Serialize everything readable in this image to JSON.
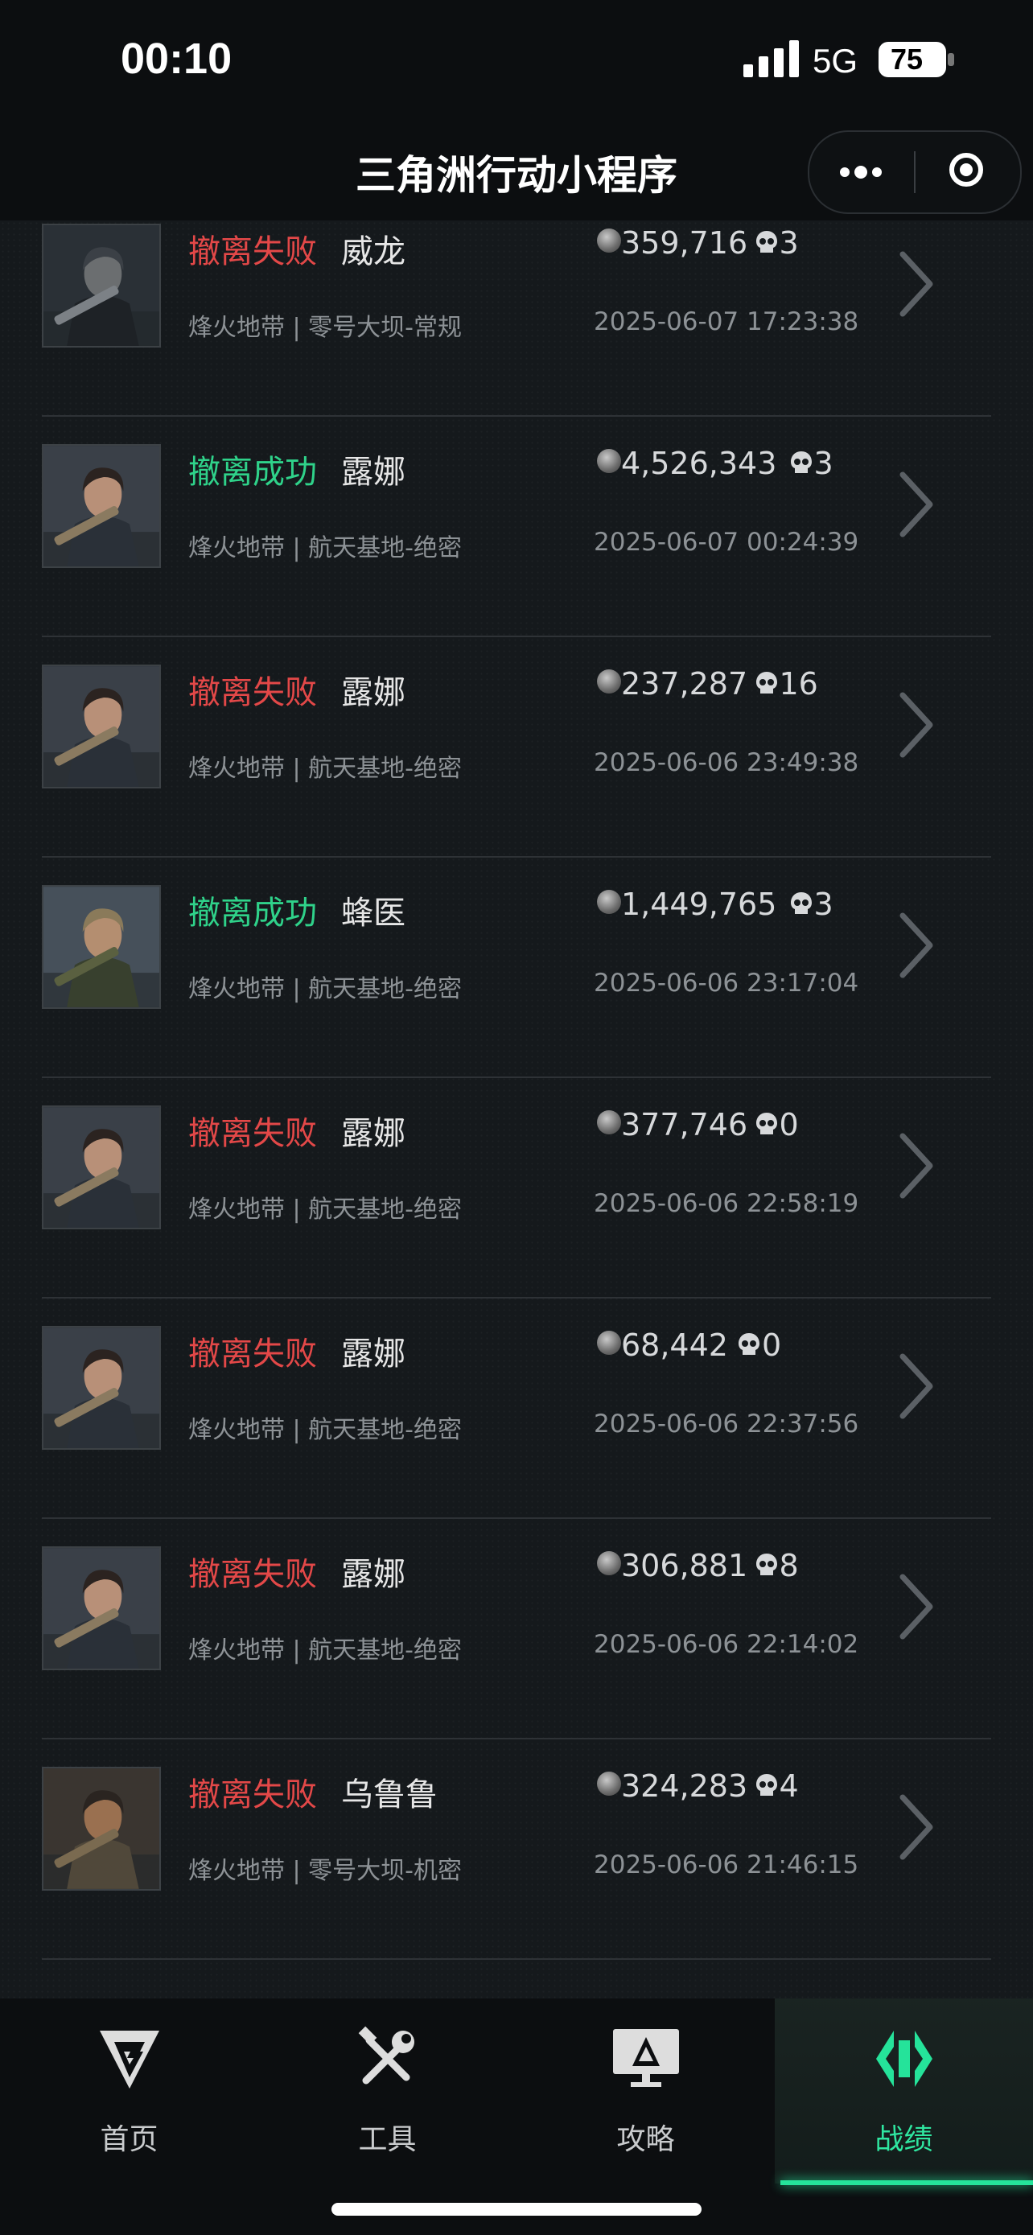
{
  "status_bar": {
    "time": "00:10",
    "network": "5G",
    "battery": "75"
  },
  "nav": {
    "title": "三角洲行动小程序"
  },
  "records": [
    {
      "result": "撤离失败",
      "result_type": "fail",
      "operator": "威龙",
      "map": "烽火地带 | 零号大坝-常规",
      "value": "359,716",
      "kills": "3",
      "time": "2025-06-07 17:23:38",
      "avatar": "weilong"
    },
    {
      "result": "撤离成功",
      "result_type": "ok",
      "operator": "露娜",
      "map": "烽火地带 | 航天基地-绝密",
      "value": "4,526,343",
      "kills": "3",
      "time": "2025-06-07 00:24:39",
      "avatar": "luna"
    },
    {
      "result": "撤离失败",
      "result_type": "fail",
      "operator": "露娜",
      "map": "烽火地带 | 航天基地-绝密",
      "value": "237,287",
      "kills": "16",
      "time": "2025-06-06 23:49:38",
      "avatar": "luna"
    },
    {
      "result": "撤离成功",
      "result_type": "ok",
      "operator": "蜂医",
      "map": "烽火地带 | 航天基地-绝密",
      "value": "1,449,765",
      "kills": "3",
      "time": "2025-06-06 23:17:04",
      "avatar": "fengyi"
    },
    {
      "result": "撤离失败",
      "result_type": "fail",
      "operator": "露娜",
      "map": "烽火地带 | 航天基地-绝密",
      "value": "377,746",
      "kills": "0",
      "time": "2025-06-06 22:58:19",
      "avatar": "luna"
    },
    {
      "result": "撤离失败",
      "result_type": "fail",
      "operator": "露娜",
      "map": "烽火地带 | 航天基地-绝密",
      "value": "68,442",
      "kills": "0",
      "time": "2025-06-06 22:37:56",
      "avatar": "luna"
    },
    {
      "result": "撤离失败",
      "result_type": "fail",
      "operator": "露娜",
      "map": "烽火地带 | 航天基地-绝密",
      "value": "306,881",
      "kills": "8",
      "time": "2025-06-06 22:14:02",
      "avatar": "luna"
    },
    {
      "result": "撤离失败",
      "result_type": "fail",
      "operator": "乌鲁鲁",
      "map": "烽火地带 | 零号大坝-机密",
      "value": "324,283",
      "kills": "4",
      "time": "2025-06-06 21:46:15",
      "avatar": "wululu"
    }
  ],
  "tabs": [
    {
      "label": "首页",
      "icon": "home-logo-icon",
      "active": false
    },
    {
      "label": "工具",
      "icon": "tools-icon",
      "active": false
    },
    {
      "label": "攻略",
      "icon": "guide-monitor-icon",
      "active": false
    },
    {
      "label": "战绩",
      "icon": "record-logo-icon",
      "active": true
    }
  ],
  "colors": {
    "fail": "#e34848",
    "success": "#2fd28a",
    "accent": "#25e39a"
  }
}
